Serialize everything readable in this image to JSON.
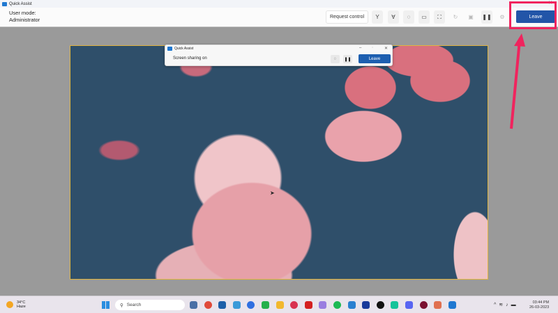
{
  "app": {
    "title": "Quick Assist"
  },
  "toolbar": {
    "user_mode_label": "User mode:",
    "user_mode_value": "Administrator",
    "request_control": "Request control",
    "leave": "Leave",
    "icons": [
      "laser-pointer-icon",
      "annotate-icon",
      "chat-icon",
      "switch-monitor-icon",
      "fit-screen-icon",
      "restart-icon",
      "task-manager-icon",
      "pause-icon",
      "settings-icon"
    ]
  },
  "mini": {
    "title": "Quick Assist",
    "status": "Screen sharing on",
    "leave": "Leave"
  },
  "taskbar": {
    "temp": "34°C",
    "condition": "Haze",
    "search": "Search",
    "time": "03:44 PM",
    "date": "26-03-2023",
    "apps": [
      {
        "name": "settings",
        "color": "#4a6fa5"
      },
      {
        "name": "chrome",
        "color": "#e04a3a"
      },
      {
        "name": "store",
        "color": "#1d5fa8"
      },
      {
        "name": "slack",
        "color": "#3a9ad9"
      },
      {
        "name": "teams",
        "color": "#2f6fe0"
      },
      {
        "name": "whatsapp",
        "color": "#25b04c"
      },
      {
        "name": "files",
        "color": "#f2b82e"
      },
      {
        "name": "app-red",
        "color": "#d93250"
      },
      {
        "name": "app-dots",
        "color": "#d42020"
      },
      {
        "name": "itunes",
        "color": "#9a7ee0"
      },
      {
        "name": "spotify",
        "color": "#1db954"
      },
      {
        "name": "mail",
        "color": "#2a80d0"
      },
      {
        "name": "app-blue",
        "color": "#1a3a9a"
      },
      {
        "name": "app-g",
        "color": "#111111"
      },
      {
        "name": "grammarly",
        "color": "#15c39a"
      },
      {
        "name": "discord",
        "color": "#5865f2"
      },
      {
        "name": "app-v",
        "color": "#7a1030"
      },
      {
        "name": "snip",
        "color": "#e07050"
      },
      {
        "name": "quick-assist",
        "color": "#1f78d1"
      }
    ]
  }
}
